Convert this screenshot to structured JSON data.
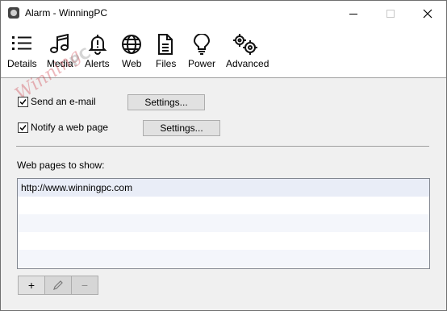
{
  "window": {
    "title": "Alarm - WinningPC",
    "icons": {
      "app": "alarm-app-icon",
      "minimize": "minimize-icon",
      "maximize": "maximize-icon",
      "close": "close-icon"
    }
  },
  "toolbar": {
    "items": [
      {
        "label": "Details",
        "icon": "list-icon"
      },
      {
        "label": "Media",
        "icon": "music-notes-icon"
      },
      {
        "label": "Alerts",
        "icon": "bell-icon"
      },
      {
        "label": "Web",
        "icon": "globe-icon"
      },
      {
        "label": "Files",
        "icon": "document-icon"
      },
      {
        "label": "Power",
        "icon": "lightbulb-icon"
      },
      {
        "label": "Advanced",
        "icon": "gears-icon"
      }
    ]
  },
  "watermark": {
    "text": "WinningPC"
  },
  "options": {
    "email": {
      "label": "Send an e-mail",
      "checked": true,
      "button": "Settings..."
    },
    "webpage": {
      "label": "Notify a web page",
      "checked": true,
      "button": "Settings..."
    }
  },
  "webpages": {
    "label": "Web pages to show:",
    "items": [
      "http://www.winningpc.com",
      "",
      "",
      "",
      ""
    ],
    "buttons": {
      "add": "+",
      "edit_icon": "pencil-icon",
      "remove": "−"
    }
  },
  "colors": {
    "watermark": "#cc3340",
    "separator": "#a0a0a0",
    "selected_row": "#e9edf7"
  }
}
